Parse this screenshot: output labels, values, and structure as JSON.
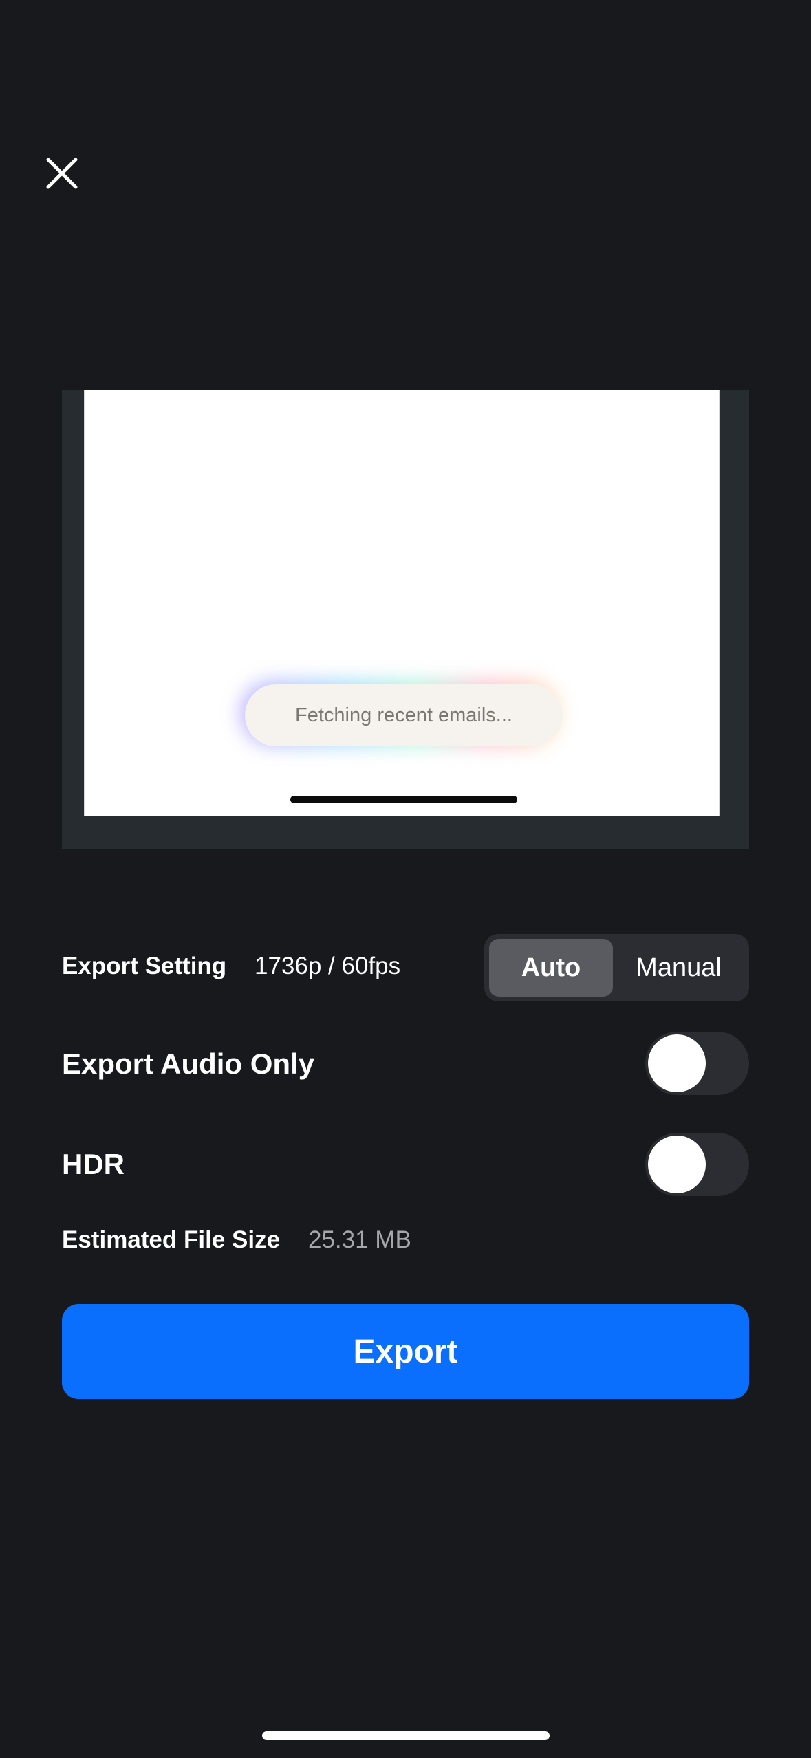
{
  "header": {
    "close_icon": "close-icon"
  },
  "preview": {
    "status_text": "Fetching recent emails..."
  },
  "settings": {
    "export_setting_label": "Export Setting",
    "export_setting_value": "1736p / 60fps",
    "mode_options": [
      "Auto",
      "Manual"
    ],
    "selected_mode": "Auto",
    "export_audio_only_label": "Export Audio Only",
    "export_audio_only_on": false,
    "hdr_label": "HDR",
    "hdr_on": false,
    "estimated_size_label": "Estimated File Size",
    "estimated_size_value": "25.31 MB"
  },
  "actions": {
    "export_label": "Export"
  },
  "colors": {
    "background": "#18191d",
    "accent": "#0a6ffd",
    "preview_frame": "#272c31"
  }
}
